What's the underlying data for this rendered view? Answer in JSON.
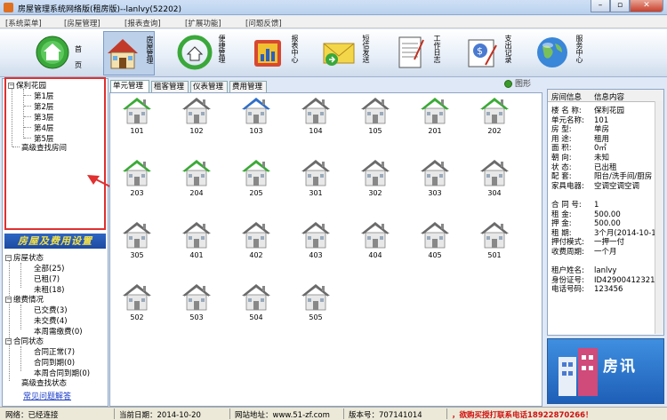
{
  "window": {
    "title": "房屋管理系统网络版(租房版)--lanlvy(52202)"
  },
  "menu": [
    "[系统菜单]",
    "[房屋管理]",
    "[报表查询]",
    "[扩展功能]",
    "[问题反馈]"
  ],
  "toolbar": [
    {
      "label": "首页",
      "icon": "home-icon"
    },
    {
      "label": "房屋管理",
      "icon": "house-icon"
    },
    {
      "label": "便捷管理",
      "icon": "recycle-house-icon"
    },
    {
      "label": "报表中心",
      "icon": "report-folder-icon"
    },
    {
      "label": "短信发送",
      "icon": "envelope-icon"
    },
    {
      "label": "工作日志",
      "icon": "notepad-icon"
    },
    {
      "label": "支出记录",
      "icon": "money-pen-icon"
    },
    {
      "label": "服务中心",
      "icon": "globe-icon"
    }
  ],
  "tree": {
    "root": "保利花园",
    "floors": [
      "第1层",
      "第2层",
      "第3层",
      "第4层",
      "第5层"
    ],
    "advanced": "高级查找房间"
  },
  "fee_header": "房屋及费用设置",
  "status_tree": {
    "house_status": "房屋状态",
    "all": "全部(25)",
    "rented": "已租(7)",
    "unrented": "未租(18)",
    "pay_status": "缴费情况",
    "paid": "已交费(3)",
    "unpaid": "未交费(4)",
    "week_due": "本周需缴费(0)",
    "contract_status": "合同状态",
    "contract_normal": "合同正常(7)",
    "contract_expired": "合同到期(0)",
    "contract_week": "本周合同到期(0)",
    "advanced": "高级查找状态"
  },
  "faq": "常见问题解答",
  "tabs": [
    "单元管理",
    "租客管理",
    "仪表管理",
    "费用管理"
  ],
  "view_toggle": "图形",
  "units": [
    {
      "num": "101",
      "state": "rented"
    },
    {
      "num": "102",
      "state": "vacant"
    },
    {
      "num": "103",
      "state": "selected"
    },
    {
      "num": "104",
      "state": "vacant"
    },
    {
      "num": "105",
      "state": "vacant"
    },
    {
      "num": "201",
      "state": "rented"
    },
    {
      "num": "202",
      "state": "rented"
    },
    {
      "num": "203",
      "state": "rented"
    },
    {
      "num": "204",
      "state": "rented"
    },
    {
      "num": "205",
      "state": "rented"
    },
    {
      "num": "301",
      "state": "vacant"
    },
    {
      "num": "302",
      "state": "vacant"
    },
    {
      "num": "303",
      "state": "vacant"
    },
    {
      "num": "304",
      "state": "vacant"
    },
    {
      "num": "305",
      "state": "vacant"
    },
    {
      "num": "401",
      "state": "vacant"
    },
    {
      "num": "402",
      "state": "vacant"
    },
    {
      "num": "403",
      "state": "vacant"
    },
    {
      "num": "404",
      "state": "vacant"
    },
    {
      "num": "405",
      "state": "vacant"
    },
    {
      "num": "501",
      "state": "vacant"
    },
    {
      "num": "502",
      "state": "vacant"
    },
    {
      "num": "503",
      "state": "vacant"
    },
    {
      "num": "504",
      "state": "vacant"
    },
    {
      "num": "505",
      "state": "vacant"
    }
  ],
  "colors": {
    "rented": "#3aaa35",
    "vacant": "#6a6a6a",
    "selected": "#2f6fc8"
  },
  "info": {
    "header_key": "房间信息",
    "header_val": "信息内容",
    "rows": [
      [
        "楼 名 称:",
        "保利花园"
      ],
      [
        "单元名称:",
        "101"
      ],
      [
        "房    型:",
        "单房"
      ],
      [
        "用    途:",
        "租用"
      ],
      [
        "面    积:",
        "0㎡"
      ],
      [
        "朝    向:",
        "未知"
      ],
      [
        "状    态:",
        "已出租"
      ],
      [
        "配    套:",
        "阳台/洗手间/厨房"
      ],
      [
        "家具电器:",
        "空调空调空调"
      ],
      [
        "",
        ""
      ],
      [
        "合 同 号:",
        "1"
      ],
      [
        "租    金:",
        "500.00"
      ],
      [
        "押    金:",
        "500.00"
      ],
      [
        "租    期:",
        "3个月(2014-10-1"
      ],
      [
        "押付模式:",
        "一押一付"
      ],
      [
        "收费周期:",
        "一个月"
      ],
      [
        "",
        ""
      ],
      [
        "租户姓名:",
        "lanlvy"
      ],
      [
        "身份证号:",
        "ID42900412321"
      ],
      [
        "电话号码:",
        "123456"
      ]
    ]
  },
  "promo_text": "房讯",
  "status": {
    "conn": "网络：已经连接",
    "date": "当前日期：2014-10-20",
    "site": "网站地址：www.51-zf.com",
    "version": "版本号：707141014",
    "ad": "，欲购买授打联系电话18922870266！"
  }
}
